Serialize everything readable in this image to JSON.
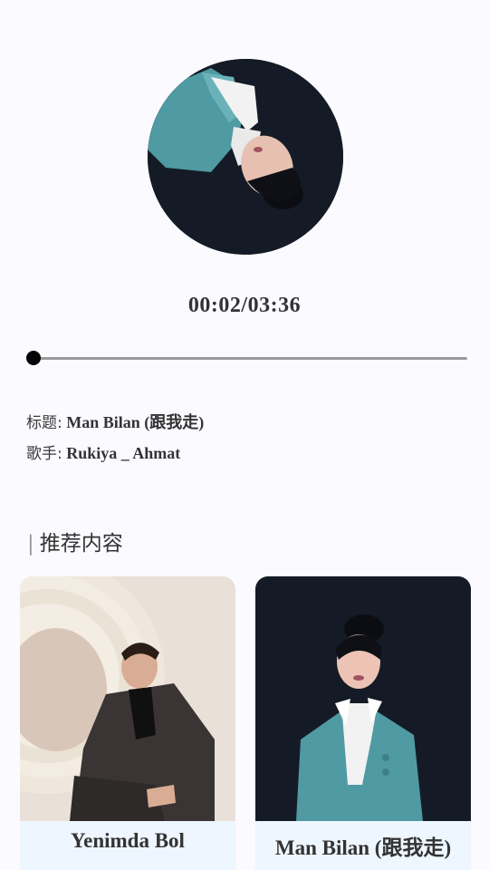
{
  "player": {
    "time_display": "00:02/03:36",
    "progress_fraction": 0.01
  },
  "song": {
    "title_label": "标题:",
    "title_value": "Man Bilan (跟我走)",
    "artist_label": "歌手:",
    "artist_value": "Rukiya _ Ahmat"
  },
  "recommend": {
    "section_bar": "|",
    "section_title": "推荐内容",
    "items": [
      {
        "title": "Yenimda Bol"
      },
      {
        "title": "Man Bilan (跟我走)"
      }
    ]
  },
  "colors": {
    "background": "#fbfaff",
    "caption_bg": "#eef6ff",
    "text": "#333333"
  }
}
